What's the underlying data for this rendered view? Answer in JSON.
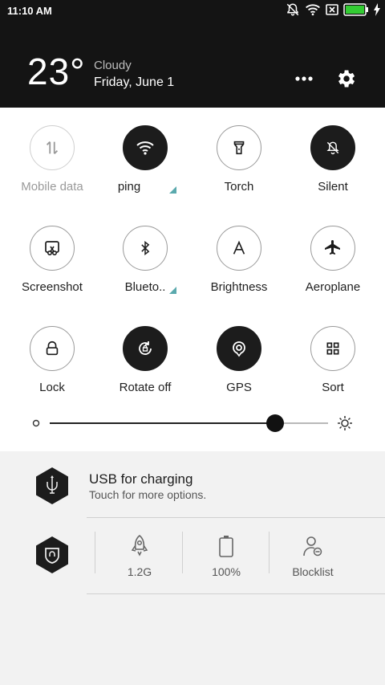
{
  "status_bar": {
    "time": "11:10 AM",
    "icons": [
      "mute-icon",
      "wifi-icon",
      "no-sim-icon",
      "battery-icon",
      "charging-icon"
    ],
    "battery_color": "#33cc33"
  },
  "header": {
    "temperature": "23°",
    "weather": "Cloudy",
    "date": "Friday, June 1",
    "more_icon": "more-dots-icon",
    "settings_icon": "gear-icon"
  },
  "toggles": [
    {
      "label": "Mobile data",
      "icon": "data-arrows-icon",
      "active": false,
      "dimmed": true,
      "expand": false
    },
    {
      "label": "ping",
      "icon": "wifi-icon",
      "active": true,
      "dimmed": false,
      "expand": true
    },
    {
      "label": "Torch",
      "icon": "torch-icon",
      "active": false,
      "dimmed": false,
      "expand": false
    },
    {
      "label": "Silent",
      "icon": "silent-bell-icon",
      "active": true,
      "dimmed": false,
      "expand": false
    },
    {
      "label": "Screenshot",
      "icon": "screenshot-icon",
      "active": false,
      "dimmed": false,
      "expand": false
    },
    {
      "label": "Blueto..",
      "icon": "bluetooth-icon",
      "active": false,
      "dimmed": false,
      "expand": true
    },
    {
      "label": "Brightness",
      "icon": "brightness-a-icon",
      "active": false,
      "dimmed": false,
      "expand": false
    },
    {
      "label": "Aeroplane",
      "icon": "aeroplane-icon",
      "active": false,
      "dimmed": false,
      "expand": false
    },
    {
      "label": "Lock",
      "icon": "lock-icon",
      "active": false,
      "dimmed": false,
      "expand": false
    },
    {
      "label": "Rotate off",
      "icon": "rotate-lock-icon",
      "active": true,
      "dimmed": false,
      "expand": false
    },
    {
      "label": "GPS",
      "icon": "gps-icon",
      "active": true,
      "dimmed": false,
      "expand": false
    },
    {
      "label": "Sort",
      "icon": "sort-grid-icon",
      "active": false,
      "dimmed": false,
      "expand": false
    }
  ],
  "brightness": {
    "level": 0.81,
    "low_icon": "brightness-low-icon",
    "high_icon": "brightness-high-icon"
  },
  "notification": {
    "title": "USB for charging",
    "subtitle": "Touch for more options.",
    "icon": "usb-trident-icon"
  },
  "quick_tools": {
    "security_icon": "security-shield-icon",
    "items": [
      {
        "label": "1.2G",
        "icon": "rocket-icon"
      },
      {
        "label": "100%",
        "icon": "battery-outline-icon"
      },
      {
        "label": "Blocklist",
        "icon": "blocklist-person-icon"
      }
    ]
  },
  "colors": {
    "accent": "#5aa9ad",
    "dark": "#141414"
  }
}
